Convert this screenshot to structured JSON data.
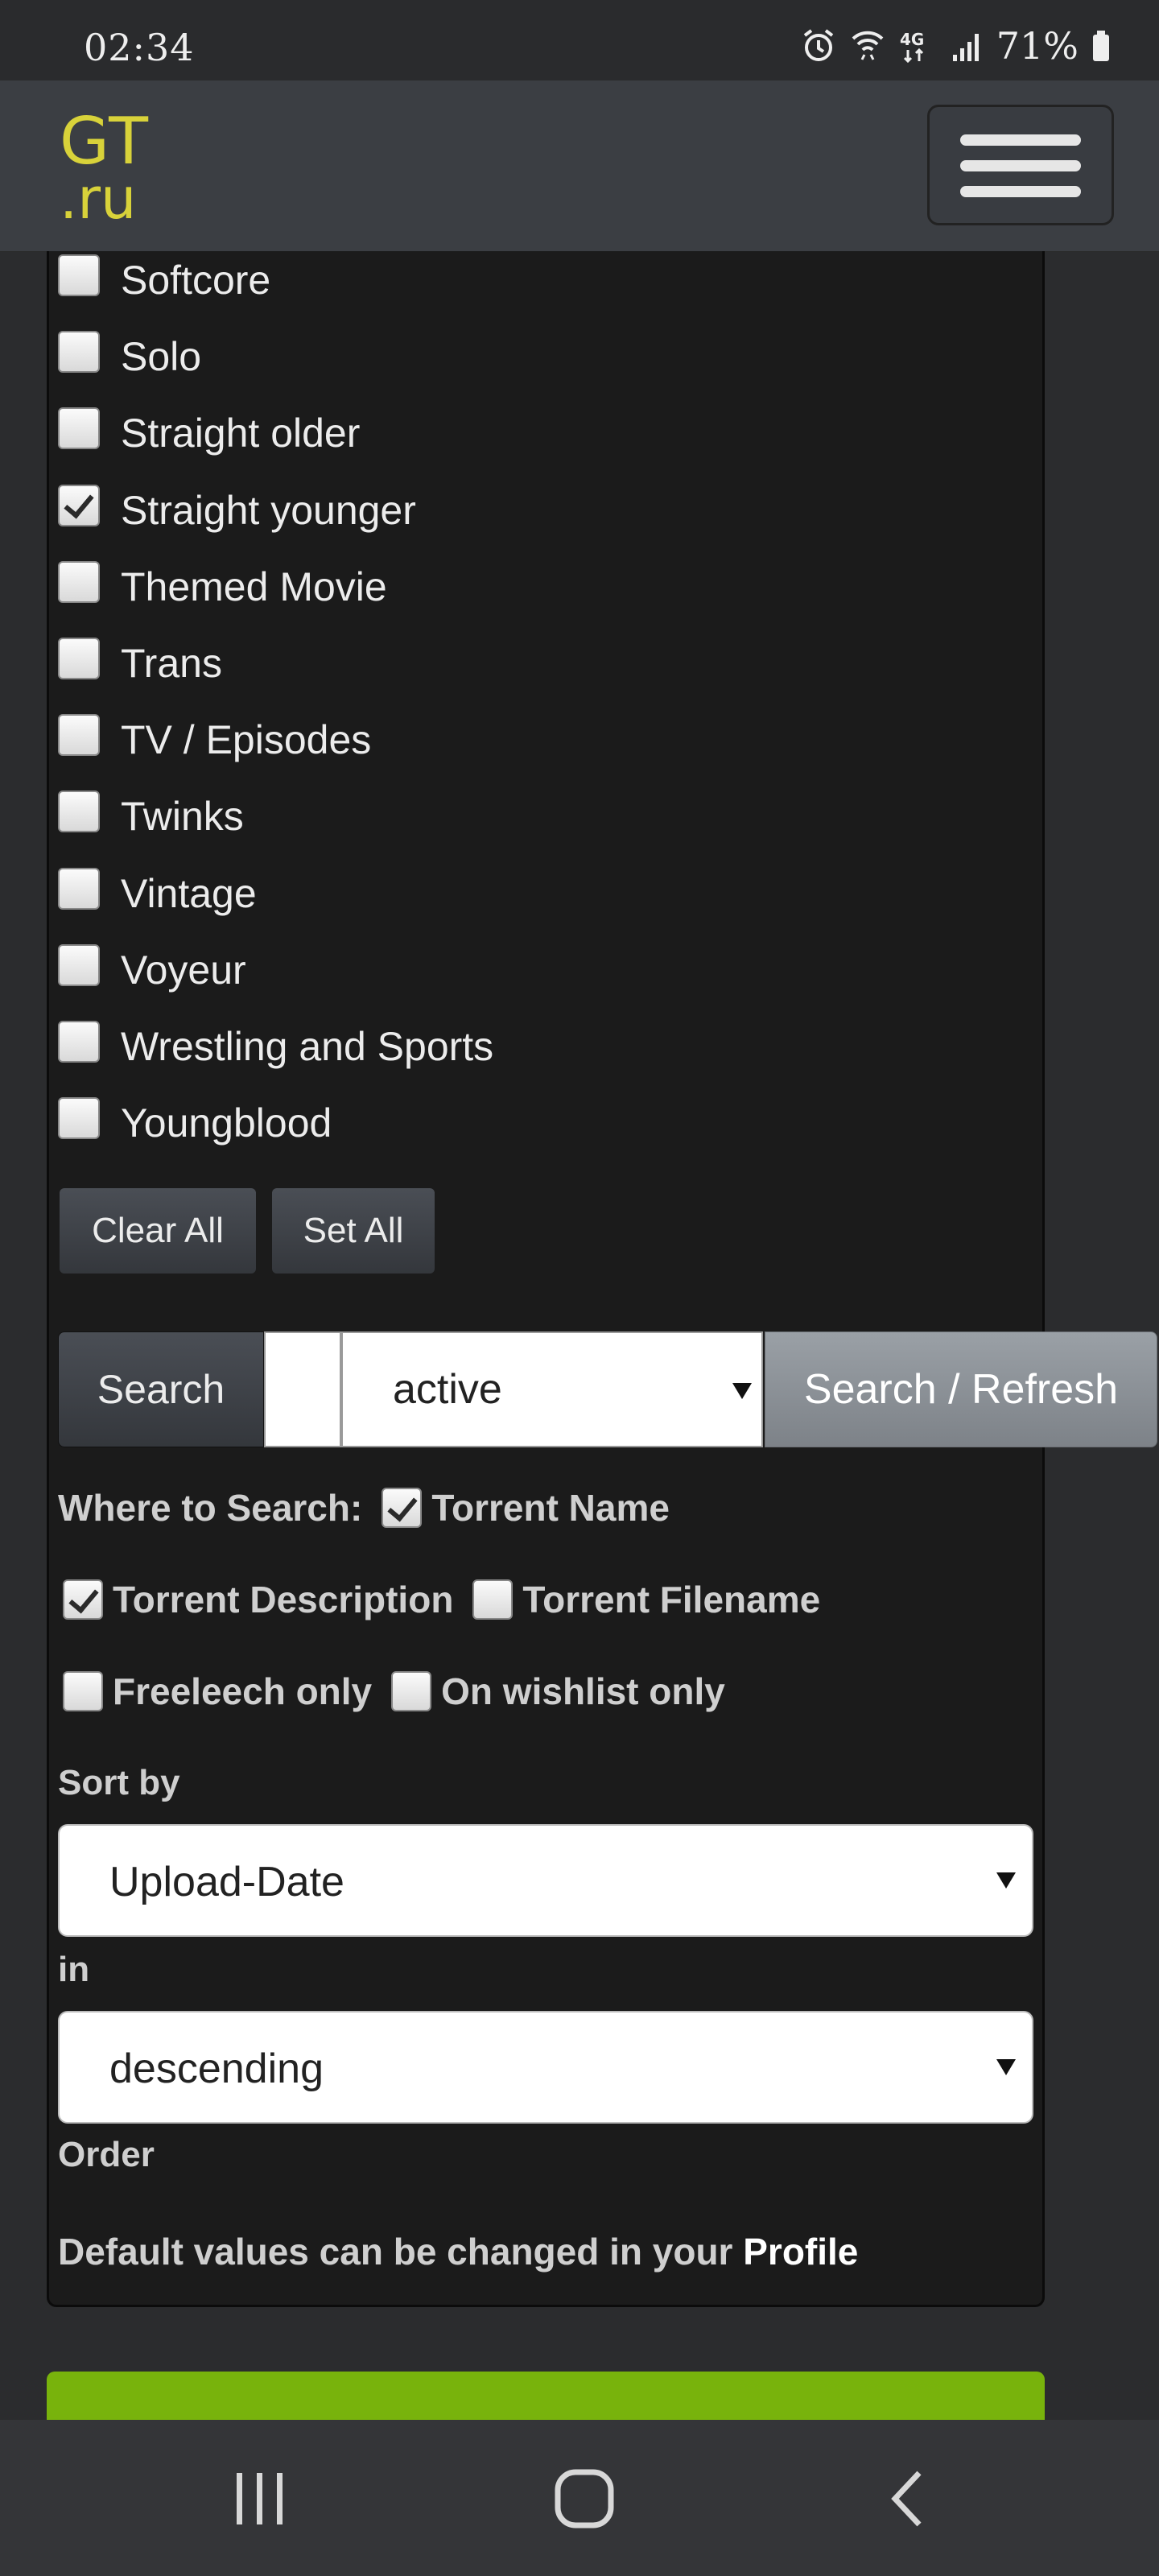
{
  "status_bar": {
    "time": "02:34",
    "battery": "71%",
    "icons": [
      "alarm-icon",
      "wifi-icon",
      "4g-lte-icon",
      "signal-icon",
      "battery-icon"
    ]
  },
  "header": {
    "logo_line1": "GT",
    "logo_line2": ".ru",
    "menu_icon": "hamburger-menu-icon",
    "logo_color": "#d8d23a"
  },
  "categories": [
    {
      "label": "Softcore",
      "checked": false
    },
    {
      "label": "Solo",
      "checked": false
    },
    {
      "label": "Straight older",
      "checked": false
    },
    {
      "label": "Straight younger",
      "checked": true
    },
    {
      "label": "Themed Movie",
      "checked": false
    },
    {
      "label": "Trans",
      "checked": false
    },
    {
      "label": "TV / Episodes",
      "checked": false
    },
    {
      "label": "Twinks",
      "checked": false
    },
    {
      "label": "Vintage",
      "checked": false
    },
    {
      "label": "Voyeur",
      "checked": false
    },
    {
      "label": "Wrestling and Sports",
      "checked": false
    },
    {
      "label": "Youngblood",
      "checked": false
    }
  ],
  "category_buttons": {
    "clear_all": "Clear All",
    "set_all": "Set All"
  },
  "search": {
    "button_label": "Search",
    "query_value": "",
    "status_selected": "active",
    "refresh_label": "Search / Refresh"
  },
  "where_to_search": {
    "label": "Where to Search:",
    "torrent_name": {
      "label": "Torrent Name",
      "checked": true
    },
    "torrent_description": {
      "label": "Torrent Description",
      "checked": true
    },
    "torrent_filename": {
      "label": "Torrent Filename",
      "checked": false
    },
    "freeleech_only": {
      "label": "Freeleech only",
      "checked": false
    },
    "on_wishlist_only": {
      "label": "On wishlist only",
      "checked": false
    }
  },
  "sort": {
    "sort_by_label": "Sort by",
    "sort_by_value": "Upload-Date",
    "in_label": "in",
    "order_value": "descending",
    "order_label": "Order"
  },
  "note": {
    "text": "Default values can be changed in your ",
    "link": "Profile"
  },
  "colors": {
    "accent_green": "#78b30c",
    "header_bg": "#3b3e43",
    "panel_bg": "#1b1b1b"
  },
  "nav_bar": {
    "icons": [
      "recent-apps-icon",
      "home-icon",
      "back-icon"
    ]
  }
}
